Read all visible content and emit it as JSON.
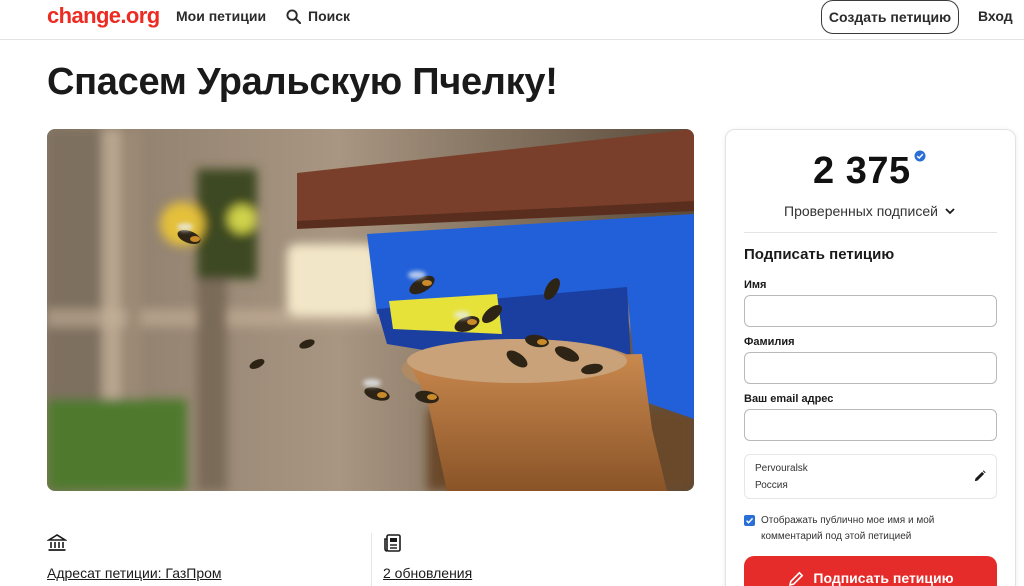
{
  "header": {
    "logo": "change.org",
    "nav_my_petitions": "Мои петиции",
    "nav_search": "Поиск",
    "create_button": "Создать петицию",
    "login": "Вход"
  },
  "petition": {
    "title": "Спасем Уральскую Пчелку!",
    "target_label": "Адресат петиции: ГазПром",
    "updates_label": "2 обновления"
  },
  "sign_card": {
    "count": "2 375",
    "verified_label": "Проверенных подписей",
    "heading": "Подписать петицию",
    "first_name_label": "Имя",
    "last_name_label": "Фамилия",
    "email_label": "Ваш email адрес",
    "first_name_value": "",
    "last_name_value": "",
    "email_value": "",
    "location_city": "Pervouralsk",
    "location_country": "Россия",
    "consent_checked": true,
    "consent_text": "Отображать публично мое имя и мой комментарий под этой петицией",
    "sign_button": "Подписать петицию"
  },
  "colors": {
    "brand_red": "#ec2c22",
    "button_red": "#e52c2a",
    "verified_blue": "#2a6fd6"
  },
  "icons": {
    "search": "search-icon",
    "verified": "verified-badge-icon",
    "chevron": "chevron-down-icon",
    "pencil": "pencil-icon",
    "target": "building-icon",
    "updates": "newspaper-icon",
    "sign": "pen-icon"
  }
}
